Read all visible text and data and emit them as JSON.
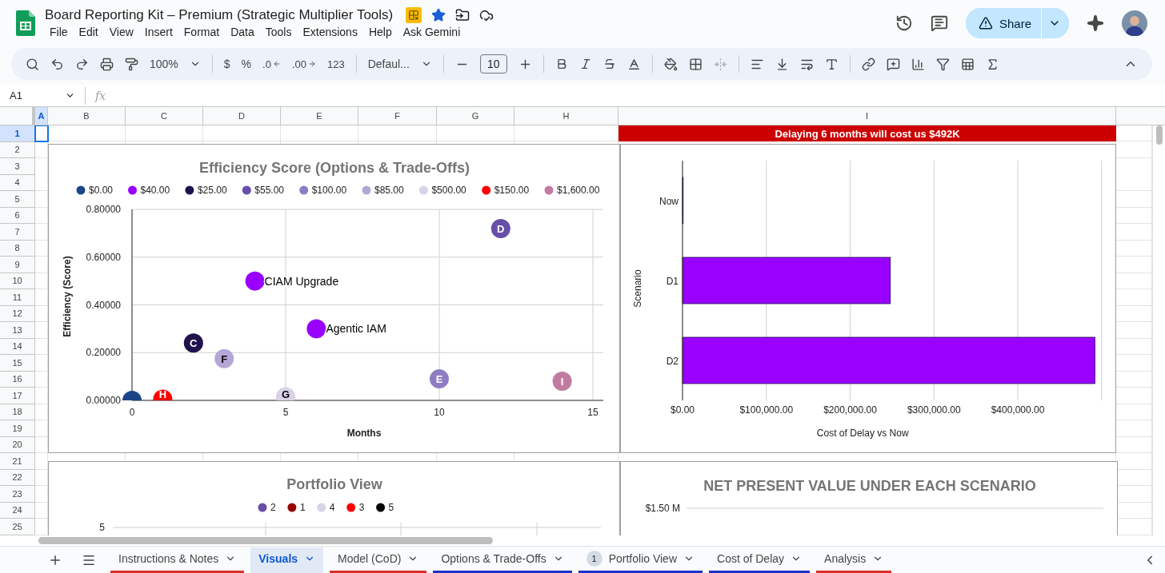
{
  "document": {
    "title": "Board Reporting Kit – Premium (Strategic Multiplier Tools)",
    "starred": true
  },
  "menu": [
    "File",
    "Edit",
    "View",
    "Insert",
    "Format",
    "Data",
    "Tools",
    "Extensions",
    "Help",
    "Ask Gemini"
  ],
  "share_button": {
    "label": "Share"
  },
  "toolbar": {
    "zoom": "100%",
    "currency": "$",
    "percent": "%",
    "decrease_decimals": ".0",
    "increase_decimals": ".00",
    "more_formats": "123",
    "font": "Defaul...",
    "font_size": "10"
  },
  "formula_bar": {
    "cell": "A1",
    "fx": "fx"
  },
  "columns": [
    {
      "label": "A",
      "selected": true
    },
    {
      "label": "B",
      "selected": false
    },
    {
      "label": "C",
      "selected": false
    },
    {
      "label": "D",
      "selected": false
    },
    {
      "label": "E",
      "selected": false
    },
    {
      "label": "F",
      "selected": false
    },
    {
      "label": "G",
      "selected": false
    },
    {
      "label": "H",
      "selected": false
    },
    {
      "label": "I",
      "selected": false
    }
  ],
  "rows": [
    {
      "label": "1",
      "selected": true
    },
    {
      "label": "2",
      "selected": false
    },
    {
      "label": "3",
      "selected": false
    },
    {
      "label": "4",
      "selected": false
    },
    {
      "label": "5",
      "selected": false
    },
    {
      "label": "6",
      "selected": false
    },
    {
      "label": "7",
      "selected": false
    },
    {
      "label": "8",
      "selected": false
    },
    {
      "label": "9",
      "selected": false
    },
    {
      "label": "10",
      "selected": false
    },
    {
      "label": "11",
      "selected": false
    },
    {
      "label": "12",
      "selected": false
    },
    {
      "label": "13",
      "selected": false
    },
    {
      "label": "14",
      "selected": false
    },
    {
      "label": "15",
      "selected": false
    },
    {
      "label": "16",
      "selected": false
    },
    {
      "label": "17",
      "selected": false
    },
    {
      "label": "18",
      "selected": false
    },
    {
      "label": "19",
      "selected": false
    },
    {
      "label": "20",
      "selected": false
    },
    {
      "label": "21",
      "selected": false
    },
    {
      "label": "22",
      "selected": false
    },
    {
      "label": "23",
      "selected": false
    },
    {
      "label": "24",
      "selected": false
    },
    {
      "label": "25",
      "selected": false
    }
  ],
  "banner": {
    "text": "Delaying 6 months will cost us $492K"
  },
  "efficiency_chart": {
    "chart_data": {
      "type": "scatter",
      "title": "Efficiency Score (Options & Trade-Offs)",
      "xlabel": "Months",
      "ylabel": "Efficiency (Score)",
      "xlim": [
        0,
        15
      ],
      "ylim": [
        0,
        0.8
      ],
      "grid": true,
      "legend": "top",
      "xticks": [
        {
          "value": 0,
          "label": "0"
        },
        {
          "value": 5,
          "label": "5"
        },
        {
          "value": 10,
          "label": "10"
        },
        {
          "value": 15,
          "label": "15"
        }
      ],
      "yticks": [
        {
          "value": 0,
          "label": "0.00000"
        },
        {
          "value": 0.2,
          "label": "0.20000"
        },
        {
          "value": 0.4,
          "label": "0.40000"
        },
        {
          "value": 0.6,
          "label": "0.60000"
        },
        {
          "value": 0.8,
          "label": "0.80000"
        }
      ],
      "series": [
        {
          "name": "$0.00",
          "color": "#1c4587",
          "x": [
            0
          ],
          "values": [
            0
          ]
        },
        {
          "name": "$40.00",
          "color": "#9900ff",
          "x": [
            4,
            6
          ],
          "values": [
            0.5,
            0.3
          ]
        },
        {
          "name": "$25.00",
          "color": "#20124d",
          "x": [
            2
          ],
          "values": [
            0.24
          ]
        },
        {
          "name": "$55.00",
          "color": "#674ea7",
          "x": [
            12
          ],
          "values": [
            0.72
          ]
        },
        {
          "name": "$100.00",
          "color": "#8e7cc3",
          "x": [
            10
          ],
          "values": [
            0.09
          ]
        },
        {
          "name": "$85.00",
          "color": "#b4a7d6",
          "x": [
            3
          ],
          "values": [
            0.175
          ]
        },
        {
          "name": "$500.00",
          "color": "#d9d2e9",
          "x": [
            5
          ],
          "values": [
            0.015
          ]
        },
        {
          "name": "$150.00",
          "color": "#ff0000",
          "x": [
            1
          ],
          "values": [
            0.005
          ]
        },
        {
          "name": "$1,600.00",
          "color": "#c27ba0",
          "x": [
            14
          ],
          "values": [
            0.08
          ]
        }
      ],
      "annotations": [
        {
          "x": 4,
          "y": 0.5,
          "text": "CIAM Upgrade"
        },
        {
          "x": 6,
          "y": 0.3,
          "text": "Agentic IAM"
        },
        {
          "x": 2,
          "y": 0.24,
          "text": "C"
        },
        {
          "x": 12,
          "y": 0.72,
          "text": "D"
        },
        {
          "x": 10,
          "y": 0.09,
          "text": "E"
        },
        {
          "x": 3,
          "y": 0.175,
          "text": "F"
        },
        {
          "x": 5,
          "y": 0.015,
          "text": "G"
        },
        {
          "x": 1,
          "y": 0.005,
          "text": "H"
        },
        {
          "x": 14,
          "y": 0.08,
          "text": "I"
        }
      ]
    }
  },
  "delay_chart": {
    "chart_data": {
      "type": "bar",
      "orientation": "horizontal",
      "xlabel": "Cost of Delay vs Now",
      "ylabel": "Scenario",
      "grid": true,
      "categories": [
        "Now",
        "D1",
        "D2"
      ],
      "series": [
        {
          "color": "#9900ff",
          "values": [
            0,
            248000,
            492000
          ]
        }
      ],
      "xlim": [
        0,
        500000
      ],
      "xticks": [
        {
          "value": 0,
          "label": "$0.00"
        },
        {
          "value": 100000,
          "label": "$100,000.00"
        },
        {
          "value": 200000,
          "label": "$200,000.00"
        },
        {
          "value": 300000,
          "label": "$300,000.00"
        },
        {
          "value": 400000,
          "label": "$400,000.00"
        }
      ]
    }
  },
  "portfolio_chart": {
    "axis_label": "5",
    "title": "Portfolio View",
    "legend": [
      {
        "name": "2",
        "color": "#674ea7"
      },
      {
        "name": "1",
        "color": "#990000"
      },
      {
        "name": "4",
        "color": "#d9d2e9"
      },
      {
        "name": "3",
        "color": "#ff0000"
      },
      {
        "name": "5",
        "color": "#000000"
      }
    ]
  },
  "npv_chart": {
    "title": "NET PRESENT VALUE UNDER EACH SCENARIO",
    "axis_label": "$1.50 M"
  },
  "sheet_tabs": [
    {
      "label": "Instructions & Notes",
      "selected": false,
      "color": "#d93025"
    },
    {
      "label": "Visuals",
      "selected": true,
      "color": "#e1e9f7"
    },
    {
      "label": "Model (CoD)",
      "selected": false,
      "color": "#d93025"
    },
    {
      "label": "Options & Trade-Offs",
      "selected": false,
      "color": "#1a33c7"
    },
    {
      "label": "Portfolio View",
      "selected": false,
      "color": "#1a33c7",
      "badge": "1"
    },
    {
      "label": "Cost of Delay",
      "selected": false,
      "color": "#1a33c7"
    },
    {
      "label": "Analysis",
      "selected": false,
      "color": "#d93025"
    }
  ]
}
